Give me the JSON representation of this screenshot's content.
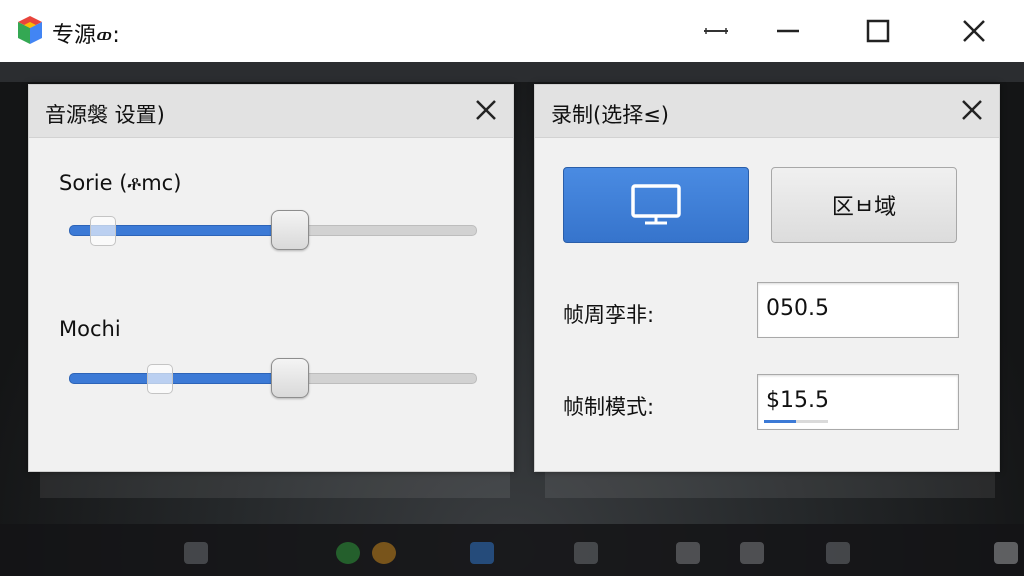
{
  "window": {
    "title": "专源ወ:"
  },
  "audio_panel": {
    "title": "音源褩 设置)",
    "sliders": [
      {
        "label": "Sorie (ቶmc)",
        "value_percent": 54
      },
      {
        "label": "Mochi",
        "value_percent": 54
      }
    ]
  },
  "record_panel": {
    "title": "录制(选择≤)",
    "mode_buttons": {
      "screen_icon": "monitor-icon",
      "region_label": "区ㅂ域",
      "selected": "screen"
    },
    "fields": [
      {
        "label": "帧周孪非:",
        "value": "050.5"
      },
      {
        "label": "帧制模式:",
        "value": "$15.5",
        "progress_percent": 50
      }
    ]
  },
  "colors": {
    "accent": "#3c7ad6",
    "panel_bg": "#f1f1f1",
    "header_bg": "#e2e2e2"
  }
}
